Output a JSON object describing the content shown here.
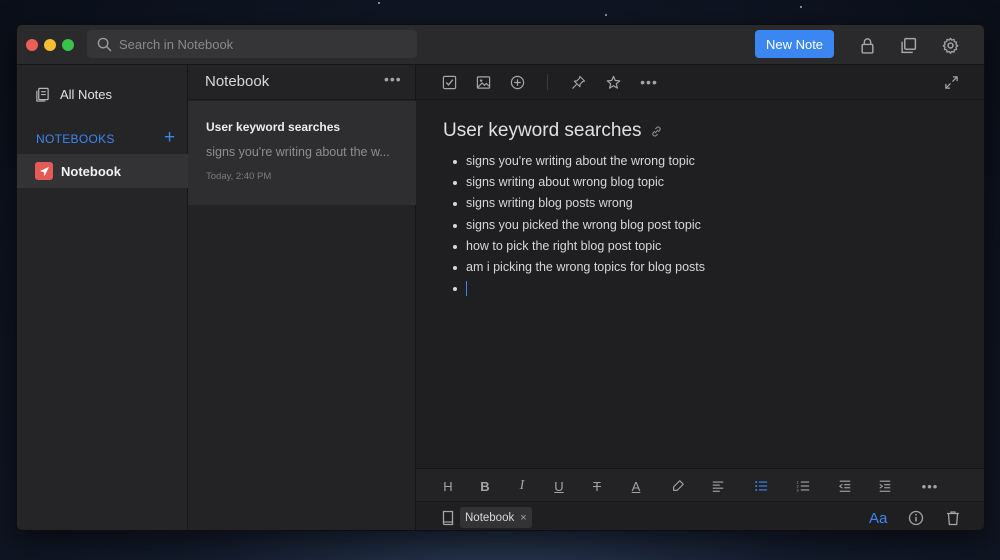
{
  "colors": {
    "accent": "#3b86f1",
    "notebook_icon": "#e45b56",
    "traffic_red": "#ed5f56",
    "traffic_yellow": "#f4bf30",
    "traffic_green": "#39c248"
  },
  "titlebar": {
    "search_placeholder": "Search in Notebook",
    "new_note_label": "New Note",
    "icons": [
      "lock-icon",
      "duplicate-icon",
      "gear-icon"
    ]
  },
  "sidebar": {
    "all_notes_label": "All Notes",
    "notebooks_header": "NOTEBOOKS",
    "add_symbol": "+",
    "notebooks": [
      {
        "label": "Notebook",
        "selected": true
      }
    ]
  },
  "notelist": {
    "title": "Notebook",
    "more_symbol": "•••",
    "notes": [
      {
        "title": "User keyword searches",
        "snippet": "signs you're writing about the w...",
        "date": "Today, 2:40 PM"
      }
    ]
  },
  "editor": {
    "toolbar_icons": [
      "checkbox-icon",
      "image-icon",
      "add-circle-icon",
      "pin-icon",
      "star-icon",
      "more-icon",
      "expand-icon"
    ],
    "more_symbol": "•••",
    "title": "User keyword searches",
    "bullets": [
      "signs you're writing about the wrong topic",
      "signs writing about wrong blog topic",
      "signs writing blog posts wrong",
      "signs you picked the wrong blog post topic",
      "how to pick the right blog post topic",
      "am i picking the wrong topics for blog posts",
      ""
    ],
    "format_bar": {
      "heading": "H",
      "bold": "B",
      "italic": "I",
      "underline": "U",
      "strike": "T",
      "color": "A",
      "more": "•••",
      "active": "bullet-list"
    },
    "footer": {
      "tag_label": "Notebook",
      "tag_remove": "×",
      "font_label": "Aa"
    }
  }
}
